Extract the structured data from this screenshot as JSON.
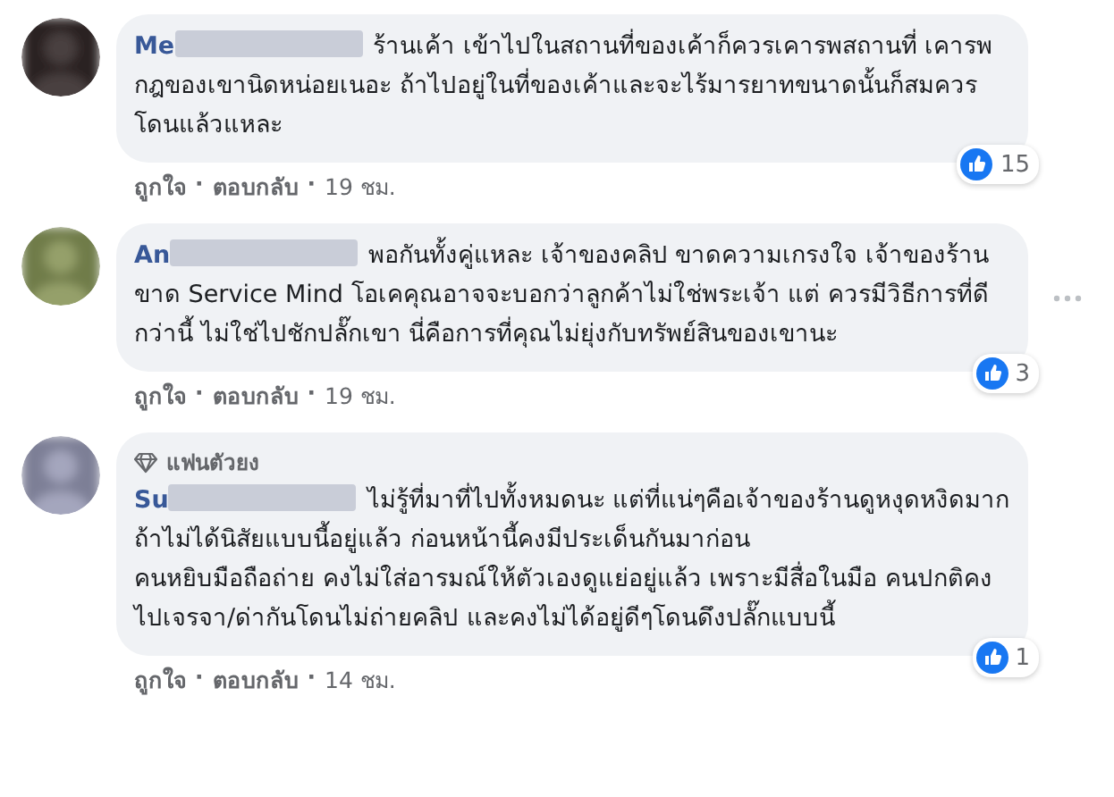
{
  "comments": [
    {
      "author": "Me",
      "text": "ร้านเค้า เข้าไปในสถานที่ของเค้าก็ควรเคารพสถานที่ เคารพกฎของเขานิดหน่อยเนอะ ถ้าไปอยู่ในที่ของเค้าและจะไร้มารยาทขนาดนั้นก็สมควรโดนแล้วแหละ",
      "reaction_count": "15",
      "actions": [
        {
          "kind": "like",
          "text": "ถูกใจ"
        },
        {
          "kind": "separator",
          "text": "·"
        },
        {
          "kind": "reply",
          "text": "ตอบกลับ"
        },
        {
          "kind": "separator",
          "text": "·"
        },
        {
          "kind": "time",
          "text": "19 ชม."
        }
      ],
      "more_menu": false
    },
    {
      "author": "An",
      "text": "พอกันทั้งคู่แหละ เจ้าของคลิป ขาดความเกรงใจ เจ้าของร้าน ขาด Service Mind โอเคคุณอาจจะบอกว่าลูกค้าไม่ใช่พระเจ้า แต่ ควรมีวิธีการที่ดีกว่านี้ ไม่ใช่ไปชักปลั๊กเขา นี่คือการที่คุณไม่ยุ่งกับทรัพย์สินของเขานะ",
      "reaction_count": "3",
      "actions": [
        {
          "kind": "like",
          "text": "ถูกใจ"
        },
        {
          "kind": "separator",
          "text": "·"
        },
        {
          "kind": "reply",
          "text": "ตอบกลับ"
        },
        {
          "kind": "separator",
          "text": "·"
        },
        {
          "kind": "time",
          "text": "19 ชม."
        }
      ],
      "more_menu": true
    },
    {
      "author": "Su",
      "badge": "แฟนตัวยง",
      "text": "ไม่รู้ที่มาที่ไปทั้งหมดนะ แต่ที่แน่ๆคือเจ้าของร้านดูหงุดหงิดมาก ถ้าไม่ได้นิสัยแบบนี้อยู่แล้ว ก่อนหน้านี้คงมีประเด็นกันมาก่อน\nคนหยิบมือถือถ่าย คงไม่ใส่อารมณ์ให้ตัวเองดูแย่อยู่แล้ว เพราะมีสื่อในมือ คนปกติคงไปเจรจา/ด่ากันโดนไม่ถ่ายคลิป และคงไม่ได้อยู่ดีๆโดนดึงปลั๊กแบบนี้",
      "reaction_count": "1",
      "actions": [
        {
          "kind": "like",
          "text": "ถูกใจ"
        },
        {
          "kind": "separator",
          "text": "·"
        },
        {
          "kind": "reply",
          "text": "ตอบกลับ"
        },
        {
          "kind": "separator",
          "text": "·"
        },
        {
          "kind": "time",
          "text": "14 ชม."
        }
      ],
      "more_menu": false
    }
  ]
}
